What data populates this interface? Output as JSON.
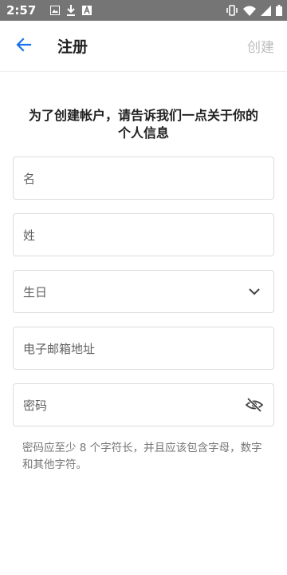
{
  "status_bar": {
    "time": "2:57",
    "icons": [
      "image-icon",
      "download-icon",
      "app-notification-icon",
      "vibrate-icon",
      "wifi-icon",
      "signal-icon",
      "battery-icon"
    ]
  },
  "app_bar": {
    "back_icon": "arrow-back-icon",
    "title": "注册",
    "action_label": "创建"
  },
  "main": {
    "heading": "为了创建帐户，请告诉我们一点关于你的个人信息",
    "fields": [
      {
        "placeholder": "名"
      },
      {
        "placeholder": "姓"
      },
      {
        "placeholder": "生日",
        "icon": "chevron-down-icon"
      },
      {
        "placeholder": "电子邮箱地址"
      },
      {
        "placeholder": "密码",
        "icon": "visibility-off-icon"
      }
    ],
    "password_hint": "密码应至少 8 个字符长，并且应该包含字母，数字和其他字符。"
  },
  "colors": {
    "status_bar": "#757575",
    "accent": "#1a73e8",
    "disabled_action": "#bdbdbd",
    "field_border": "#dadce0"
  }
}
